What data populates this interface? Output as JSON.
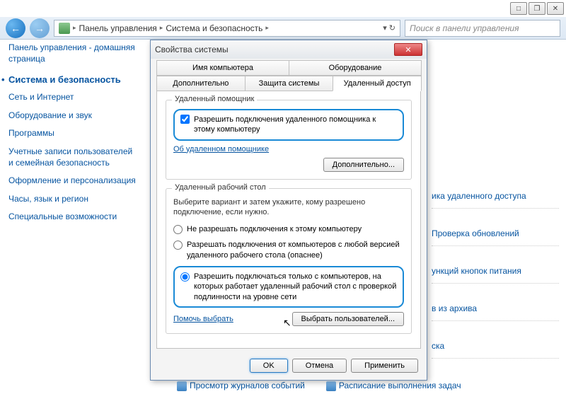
{
  "chrome": {
    "minimize": "□",
    "maximize": "❐",
    "close": "✕"
  },
  "nav": {
    "bc1": "Панель управления",
    "bc2": "Система и безопасность",
    "search_placeholder": "Поиск в панели управления"
  },
  "sidebar": {
    "home": "Панель управления - домашняя страница",
    "active": "Система и безопасность",
    "items": [
      "Сеть и Интернет",
      "Оборудование и звук",
      "Программы",
      "Учетные записи пользователей и семейная безопасность",
      "Оформление и персонализация",
      "Часы, язык и регион",
      "Специальные возможности"
    ]
  },
  "right": {
    "items": [
      "ика удаленного доступа",
      "Проверка обновлений",
      "ункций кнопок питания",
      "в из архива",
      "ска"
    ]
  },
  "dialog": {
    "title": "Свойства системы",
    "tabs_row1": [
      "Имя компьютера",
      "Оборудование"
    ],
    "tabs_row2": [
      "Дополнительно",
      "Защита системы",
      "Удаленный доступ"
    ],
    "group1": {
      "title": "Удаленный помощник",
      "checkbox": "Разрешить подключения удаленного помощника к этому компьютеру",
      "link": "Об удаленном помощнике",
      "button": "Дополнительно..."
    },
    "group2": {
      "title": "Удаленный рабочий стол",
      "desc": "Выберите вариант и затем укажите, кому разрешено подключение, если нужно.",
      "radio1": "Не разрешать подключения к этому компьютеру",
      "radio2": "Разрешать подключения от компьютеров с любой версией удаленного рабочего стола (опаснее)",
      "radio3": "Разрешить подключаться только с компьютеров, на которых работает удаленный рабочий стол с проверкой подлинности на уровне сети",
      "link": "Помочь выбрать",
      "button": "Выбрать пользователей..."
    },
    "buttons": {
      "ok": "OK",
      "cancel": "Отмена",
      "apply": "Применить"
    }
  },
  "bottom": {
    "link1": "Просмотр журналов событий",
    "link2": "Расписание выполнения задач"
  }
}
